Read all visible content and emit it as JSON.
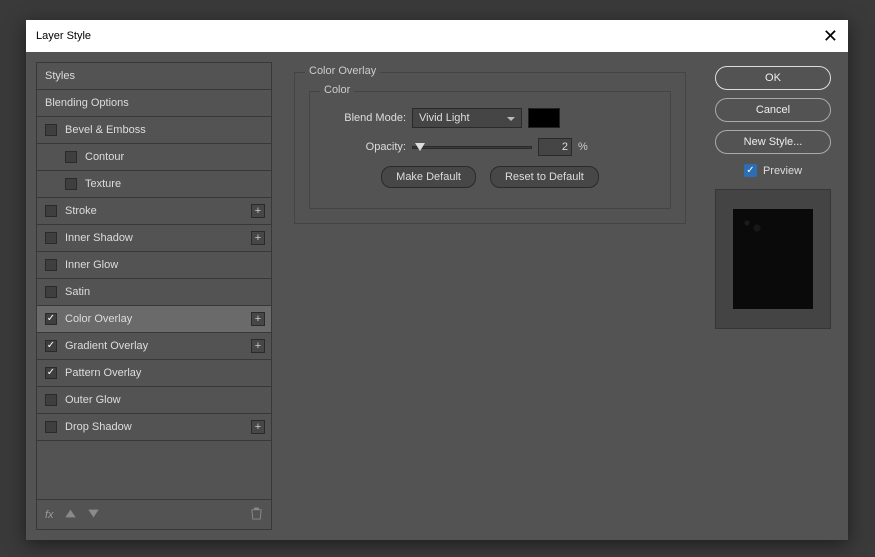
{
  "dialog": {
    "title": "Layer Style"
  },
  "left": {
    "header": "Styles",
    "blending": "Blending Options",
    "items": [
      {
        "label": "Bevel & Emboss",
        "checked": false,
        "plus": false
      },
      {
        "label": "Contour",
        "checked": false,
        "indent": true
      },
      {
        "label": "Texture",
        "checked": false,
        "indent": true
      },
      {
        "label": "Stroke",
        "checked": false,
        "plus": true
      },
      {
        "label": "Inner Shadow",
        "checked": false,
        "plus": true
      },
      {
        "label": "Inner Glow",
        "checked": false
      },
      {
        "label": "Satin",
        "checked": false
      },
      {
        "label": "Color Overlay",
        "checked": true,
        "plus": true,
        "selected": true
      },
      {
        "label": "Gradient Overlay",
        "checked": true,
        "plus": true
      },
      {
        "label": "Pattern Overlay",
        "checked": true
      },
      {
        "label": "Outer Glow",
        "checked": false
      },
      {
        "label": "Drop Shadow",
        "checked": false,
        "plus": true
      }
    ],
    "footer_fx": "fx"
  },
  "middle": {
    "panel_title": "Color Overlay",
    "group_title": "Color",
    "blend_mode_label": "Blend Mode:",
    "blend_mode_value": "Vivid Light",
    "opacity_label": "Opacity:",
    "opacity_value": "2",
    "opacity_unit": "%",
    "make_default": "Make Default",
    "reset_default": "Reset to Default",
    "swatch_color": "#000000"
  },
  "right": {
    "ok": "OK",
    "cancel": "Cancel",
    "new_style": "New Style...",
    "preview": "Preview",
    "preview_checked": true
  }
}
